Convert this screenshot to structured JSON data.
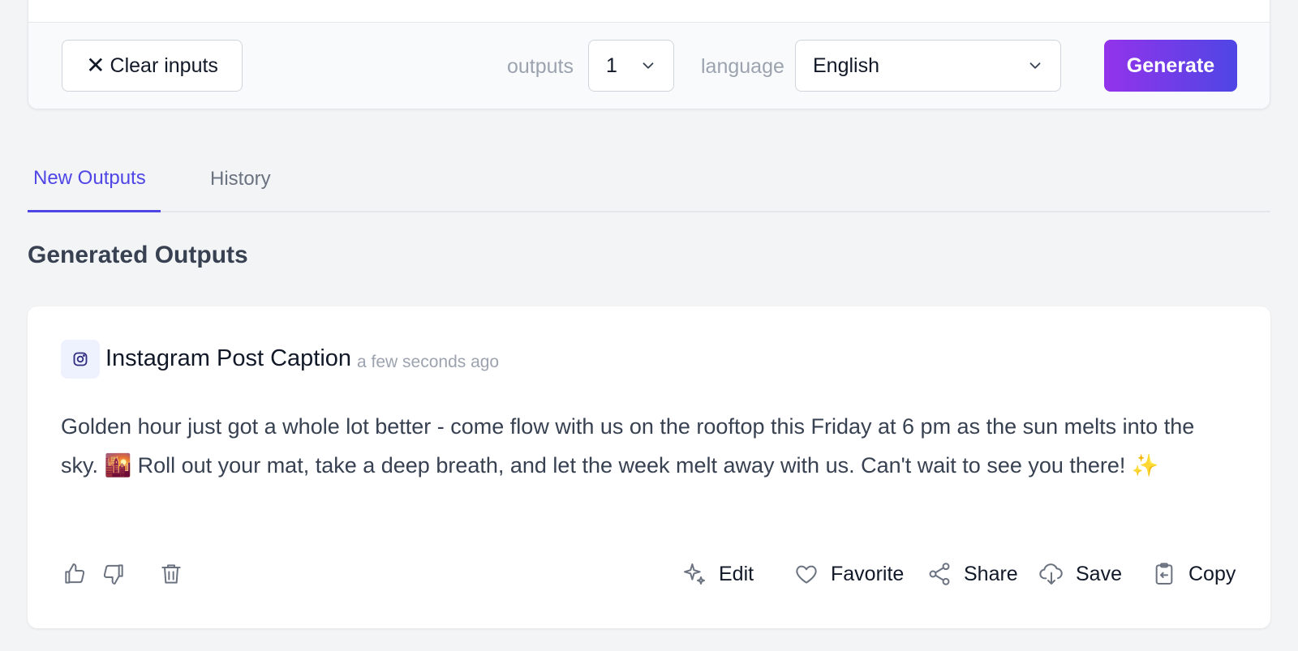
{
  "form": {
    "clear_label": "Clear inputs",
    "outputs_label": "outputs",
    "outputs_value": "1",
    "language_label": "language",
    "language_value": "English",
    "generate_label": "Generate"
  },
  "tabs": [
    {
      "label": "New Outputs",
      "active": true
    },
    {
      "label": "History",
      "active": false
    }
  ],
  "section_title": "Generated Outputs",
  "output": {
    "title": "Instagram Post Caption",
    "time": "a few seconds ago",
    "body": "Golden hour just got a whole lot better - come flow with us on the rooftop this Friday at 6 pm as the sun melts into the sky. 🌇 Roll out your mat, take a deep breath, and let the week melt away with us. Can't wait to see you there! ✨",
    "actions": {
      "edit": "Edit",
      "favorite": "Favorite",
      "share": "Share",
      "save": "Save",
      "copy": "Copy"
    }
  },
  "colors": {
    "accent": "#4f46e5",
    "generate_gradient_start": "#9333ea",
    "generate_gradient_end": "#4f46e5",
    "background": "#f3f4f6"
  }
}
